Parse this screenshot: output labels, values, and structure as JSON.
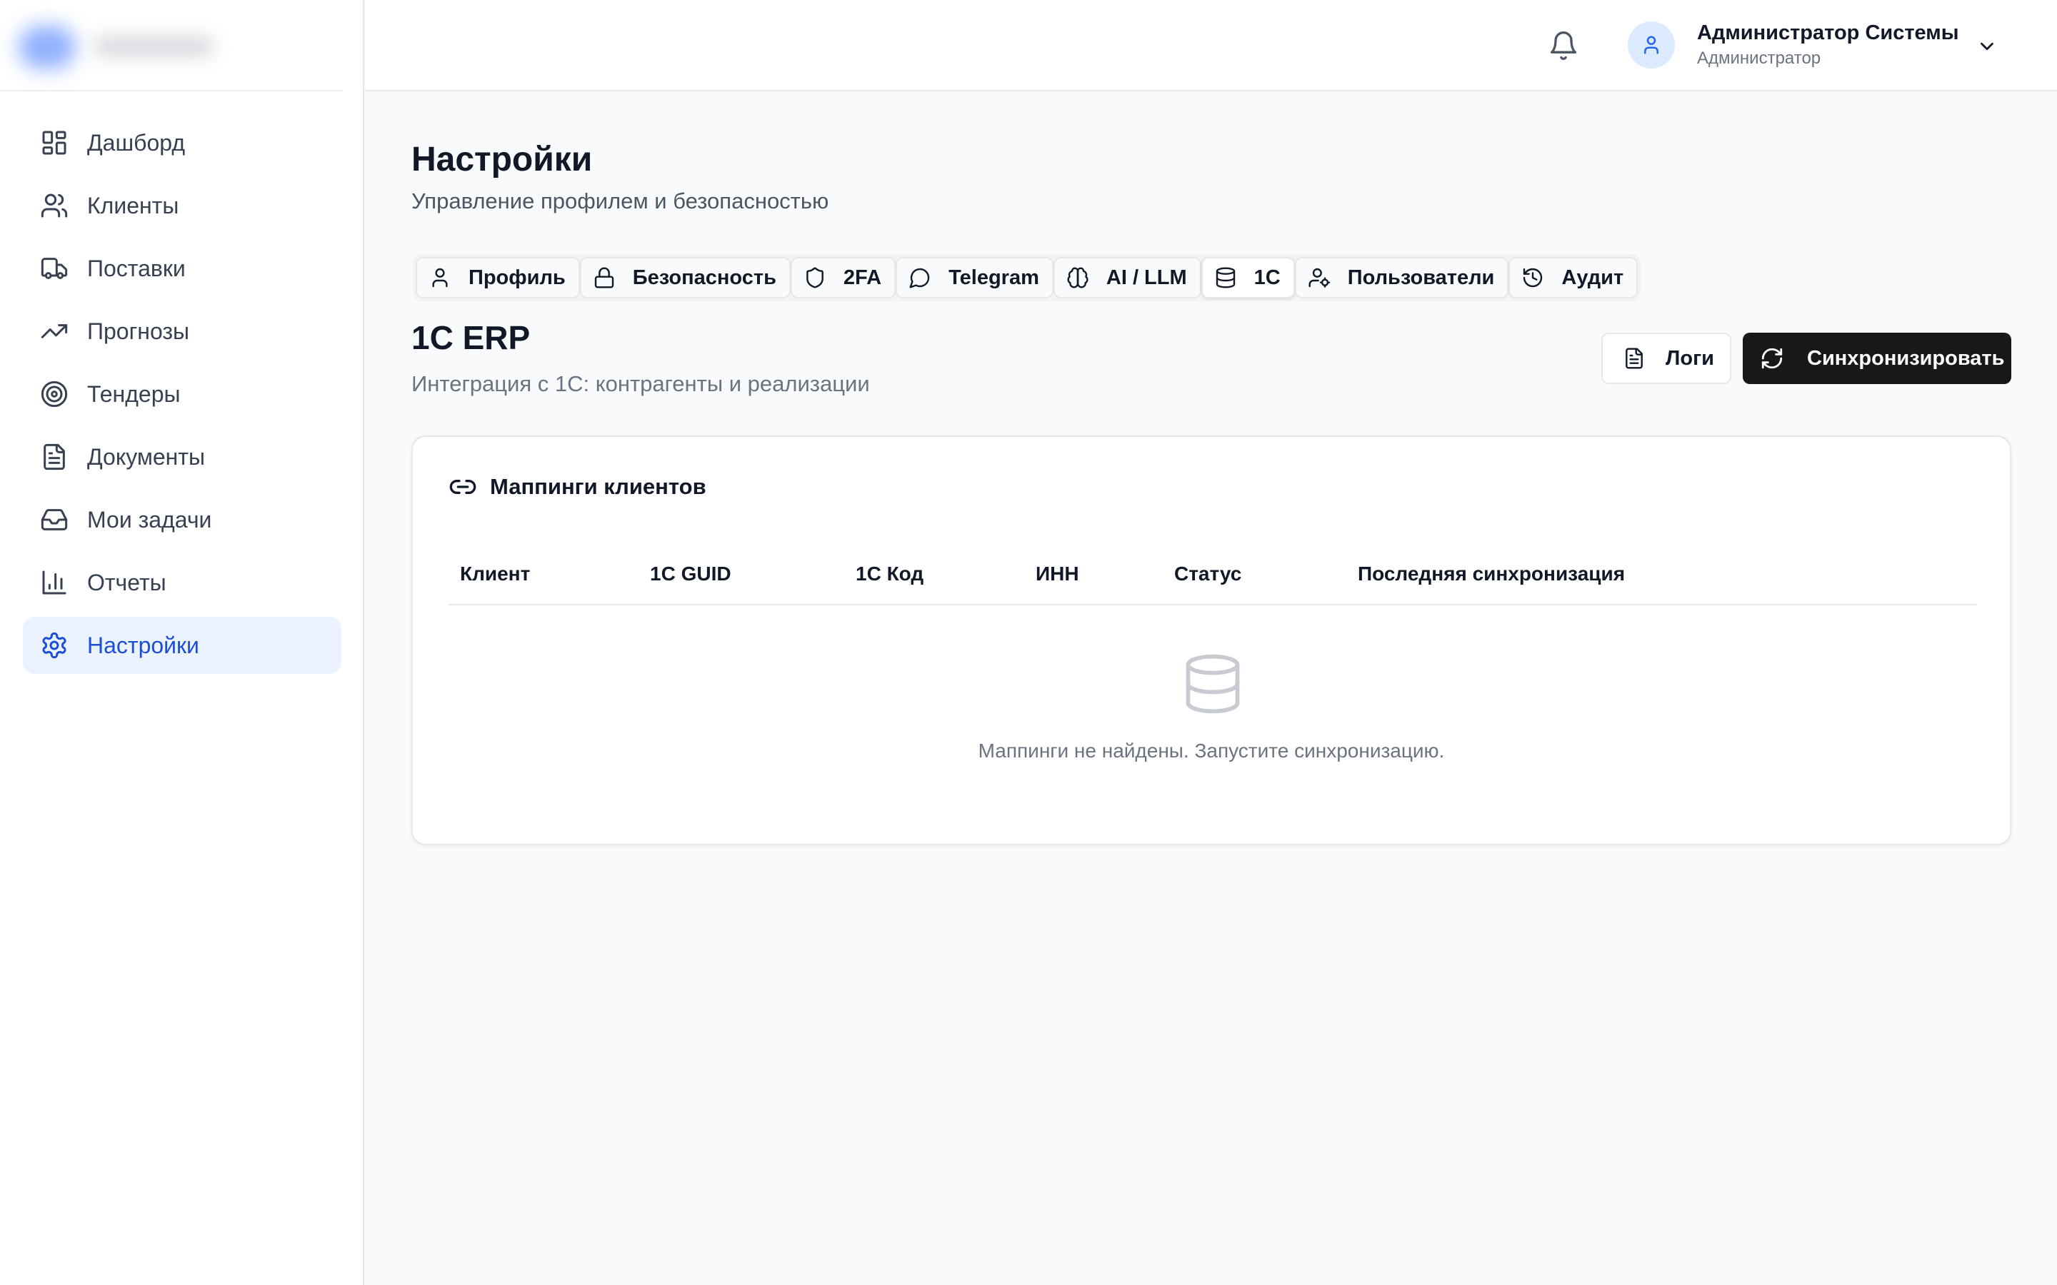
{
  "sidebar": {
    "items": [
      {
        "label": "Дашборд",
        "icon": "dashboard-icon"
      },
      {
        "label": "Клиенты",
        "icon": "users-icon"
      },
      {
        "label": "Поставки",
        "icon": "truck-icon"
      },
      {
        "label": "Прогнозы",
        "icon": "trending-up-icon"
      },
      {
        "label": "Тендеры",
        "icon": "target-icon"
      },
      {
        "label": "Документы",
        "icon": "document-icon"
      },
      {
        "label": "Мои задачи",
        "icon": "inbox-icon"
      },
      {
        "label": "Отчеты",
        "icon": "bar-chart-icon"
      },
      {
        "label": "Настройки",
        "icon": "gear-icon",
        "active": true
      }
    ]
  },
  "header": {
    "user_name": "Администратор Системы",
    "user_role": "Администратор"
  },
  "page": {
    "title": "Настройки",
    "subtitle": "Управление профилем и безопасностью"
  },
  "tabs": [
    {
      "label": "Профиль",
      "icon": "user-icon"
    },
    {
      "label": "Безопасность",
      "icon": "lock-icon"
    },
    {
      "label": "2FA",
      "icon": "shield-icon"
    },
    {
      "label": "Telegram",
      "icon": "message-circle-icon"
    },
    {
      "label": "AI / LLM",
      "icon": "brain-icon"
    },
    {
      "label": "1С",
      "icon": "database-icon",
      "active": true
    },
    {
      "label": "Пользователи",
      "icon": "user-cog-icon"
    },
    {
      "label": "Аудит",
      "icon": "history-icon"
    }
  ],
  "section": {
    "title": "1С ERP",
    "subtitle": "Интеграция с 1С: контрагенты и реализации",
    "logs_label": "Логи",
    "sync_label": "Синхронизировать"
  },
  "card": {
    "title": "Маппинги клиентов",
    "columns": [
      "Клиент",
      "1С GUID",
      "1С Код",
      "ИНН",
      "Статус",
      "Последняя синхронизация"
    ],
    "empty_text": "Маппинги не найдены. Запустите синхронизацию."
  },
  "colors": {
    "accent": "#1d4ed8",
    "active_nav_bg": "#eaf3ff",
    "primary_button": "#18181b"
  }
}
